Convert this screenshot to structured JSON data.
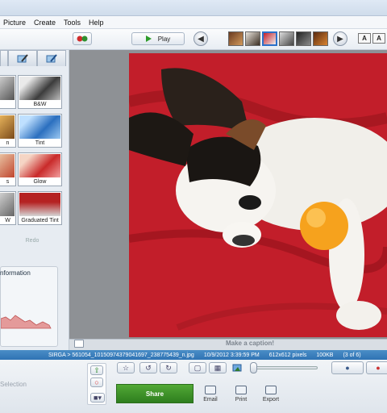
{
  "menu": [
    "Picture",
    "Create",
    "Tools",
    "Help"
  ],
  "toolbar": {
    "play_label": "Play",
    "prev_icon": "left-arrow-icon",
    "next_icon": "right-arrow-icon",
    "font_buttons": [
      "A",
      "A"
    ]
  },
  "effects": {
    "tiles": [
      {
        "label": "B&W",
        "color": "#7a7a7a"
      },
      {
        "label": "Tint",
        "color": "#3b7fc7"
      },
      {
        "label": "Glow",
        "color": "#c92a2a"
      },
      {
        "label": "Graduated Tint",
        "color": "#b52222"
      }
    ],
    "cut_labels": [
      "",
      "n",
      "s",
      "W"
    ],
    "redo_label": "Redo"
  },
  "info": {
    "title": "nformation"
  },
  "canvas": {
    "caption_placeholder": "Make a caption!"
  },
  "status": {
    "path": "SIRGA > 561054_10150974379041697_238775439_n.jpg",
    "datetime": "10/9/2012 3:39:59 PM",
    "dimensions": "612x612 pixels",
    "size": "100KB",
    "position": "(3 of 6)"
  },
  "bottom": {
    "selection_label": "Selection",
    "share_label": "Share",
    "actions": [
      "Email",
      "Print",
      "Export"
    ]
  },
  "colors": {
    "accent_green": "#3a9628",
    "status_blue": "#3a80bf",
    "photo_red": "#c41f2a"
  }
}
